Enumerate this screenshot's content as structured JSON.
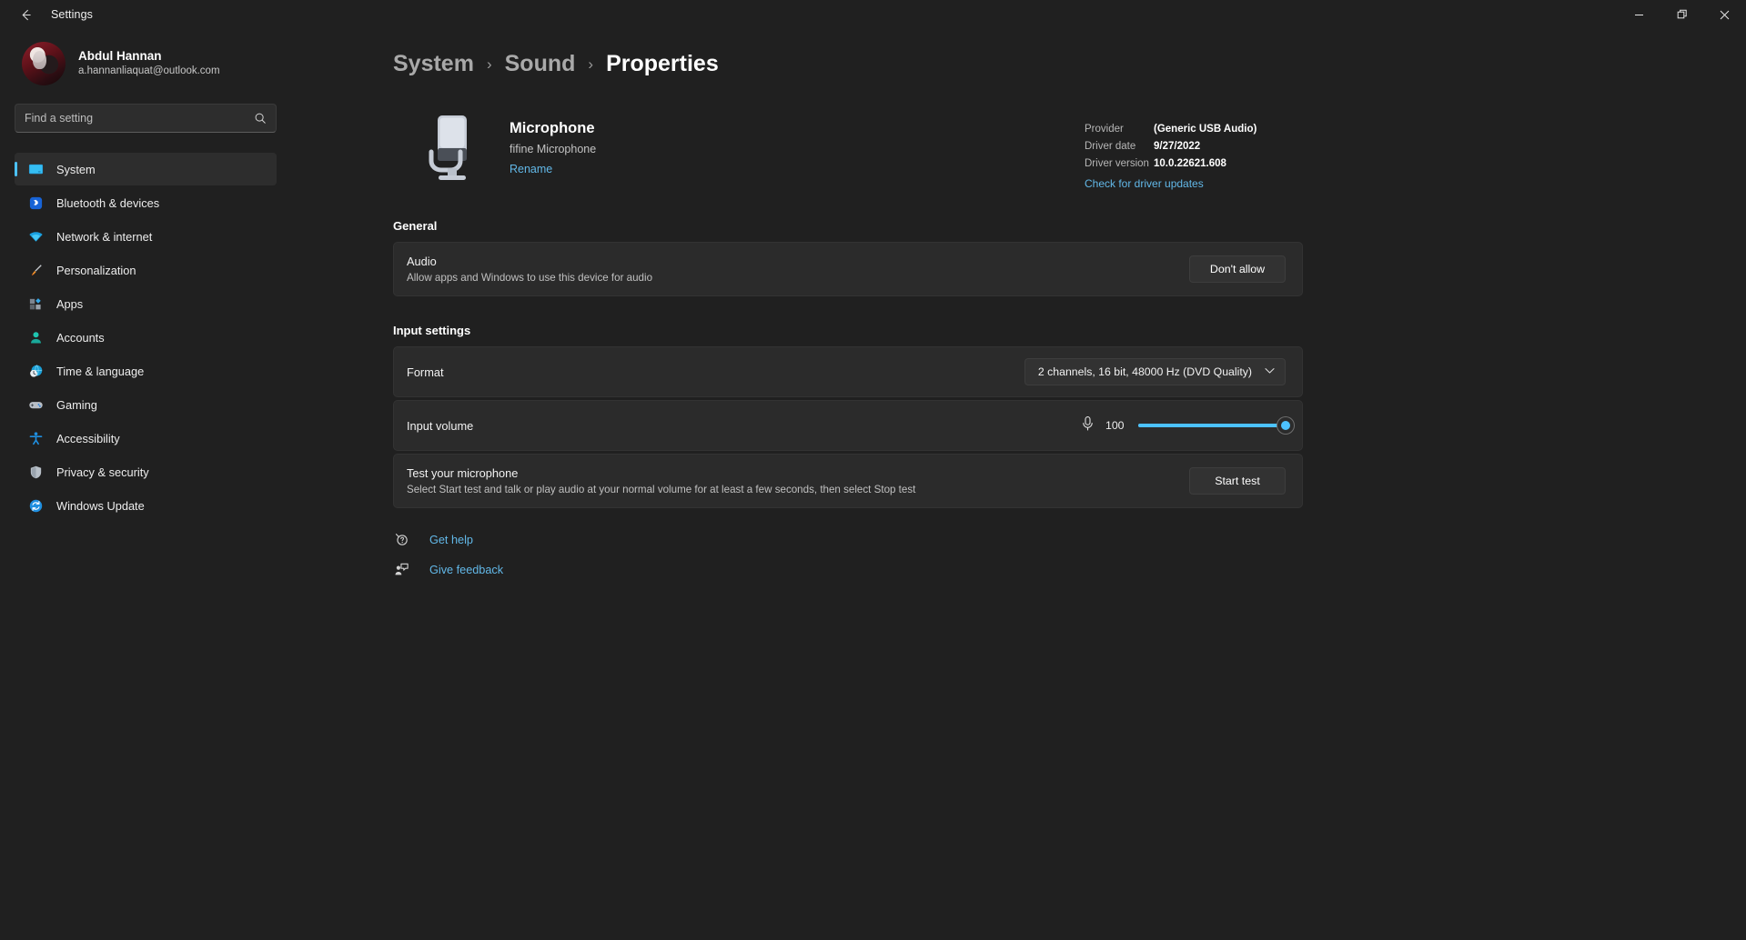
{
  "window": {
    "app_title": "Settings",
    "back_icon": "back-arrow-icon",
    "minimize_label": "Minimize",
    "maximize_label": "Restore",
    "close_label": "Close"
  },
  "sidebar": {
    "profile": {
      "name": "Abdul Hannan",
      "email": "a.hannanliaquat@outlook.com"
    },
    "search": {
      "placeholder": "Find a setting",
      "value": "",
      "icon": "search-icon"
    },
    "items": [
      {
        "label": "System",
        "icon": "monitor-icon",
        "active": true
      },
      {
        "label": "Bluetooth & devices",
        "icon": "bluetooth-icon",
        "active": false
      },
      {
        "label": "Network & internet",
        "icon": "wifi-icon",
        "active": false
      },
      {
        "label": "Personalization",
        "icon": "paintbrush-icon",
        "active": false
      },
      {
        "label": "Apps",
        "icon": "apps-icon",
        "active": false
      },
      {
        "label": "Accounts",
        "icon": "person-icon",
        "active": false
      },
      {
        "label": "Time & language",
        "icon": "clock-globe-icon",
        "active": false
      },
      {
        "label": "Gaming",
        "icon": "gamepad-icon",
        "active": false
      },
      {
        "label": "Accessibility",
        "icon": "accessibility-icon",
        "active": false
      },
      {
        "label": "Privacy & security",
        "icon": "shield-icon",
        "active": false
      },
      {
        "label": "Windows Update",
        "icon": "update-icon",
        "active": false
      }
    ]
  },
  "breadcrumb": {
    "root": "System",
    "parent": "Sound",
    "current": "Properties",
    "separator": "›"
  },
  "device": {
    "icon": "microphone-icon",
    "name": "Microphone",
    "subtitle": "fifine Microphone",
    "rename_label": "Rename",
    "driver": {
      "provider_label": "Provider",
      "provider_value": "(Generic USB Audio)",
      "date_label": "Driver date",
      "date_value": "9/27/2022",
      "version_label": "Driver version",
      "version_value": "10.0.22621.608",
      "update_link": "Check for driver updates"
    }
  },
  "general": {
    "heading": "General",
    "audio": {
      "title": "Audio",
      "description": "Allow apps and Windows to use this device for audio",
      "button": "Don't allow"
    }
  },
  "input_settings": {
    "heading": "Input settings",
    "format": {
      "label": "Format",
      "value": "2 channels, 16 bit, 48000 Hz (DVD Quality)",
      "chevron": "chevron-down-icon"
    },
    "volume": {
      "label": "Input volume",
      "icon": "microphone-icon",
      "value": "100",
      "percent": 100
    },
    "test": {
      "title": "Test your microphone",
      "description": "Select Start test and talk or play audio at your normal volume for at least a few seconds, then select Stop test",
      "button": "Start test"
    }
  },
  "footer": {
    "links": [
      {
        "label": "Get help",
        "icon": "help-icon"
      },
      {
        "label": "Give feedback",
        "icon": "feedback-icon"
      }
    ]
  },
  "colors": {
    "accent": "#4cc2ff",
    "link": "#62b8e8",
    "window_bg": "#202020",
    "card_bg": "#2b2b2b"
  }
}
